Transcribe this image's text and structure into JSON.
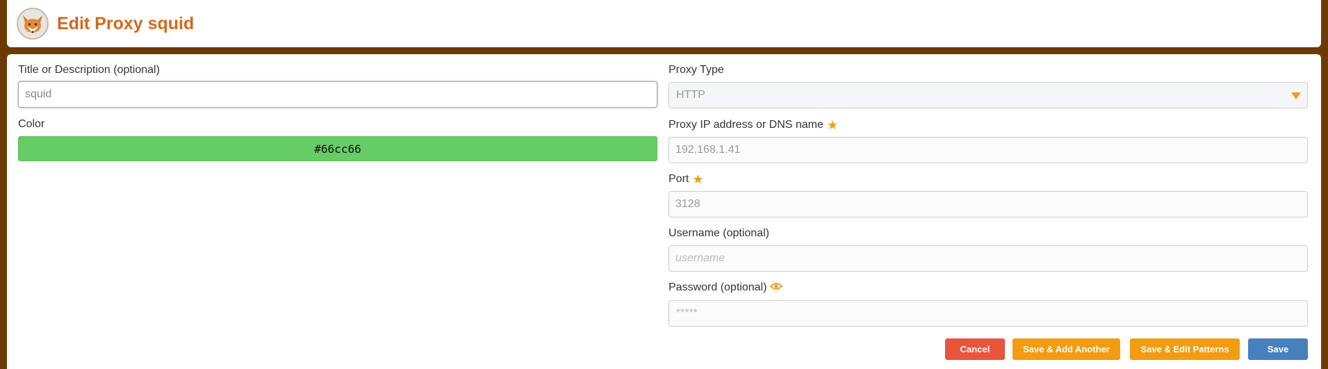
{
  "header": {
    "title": "Edit Proxy squid",
    "logo_icon": "fox-logo-icon"
  },
  "left": {
    "title_label": "Title or Description (optional)",
    "title_value": "squid",
    "color_label": "Color",
    "color_value": "#66cc66"
  },
  "right": {
    "proxy_type_label": "Proxy Type",
    "proxy_type_value": "HTTP",
    "address_label": "Proxy IP address or DNS name",
    "address_value": "192.168.1.41",
    "port_label": "Port",
    "port_value": "3128",
    "username_label": "Username (optional)",
    "username_placeholder": "username",
    "password_label": "Password (optional)",
    "password_placeholder": "*****"
  },
  "buttons": {
    "cancel": "Cancel",
    "save_add_another": "Save & Add Another",
    "save_edit_patterns": "Save & Edit Patterns",
    "save": "Save"
  },
  "colors": {
    "accent": "#f39c12",
    "title": "#d2691e",
    "background": "#6b3a06",
    "cancel": "#e8553d",
    "save": "#4781bd",
    "proxy_color": "#66cc66"
  }
}
